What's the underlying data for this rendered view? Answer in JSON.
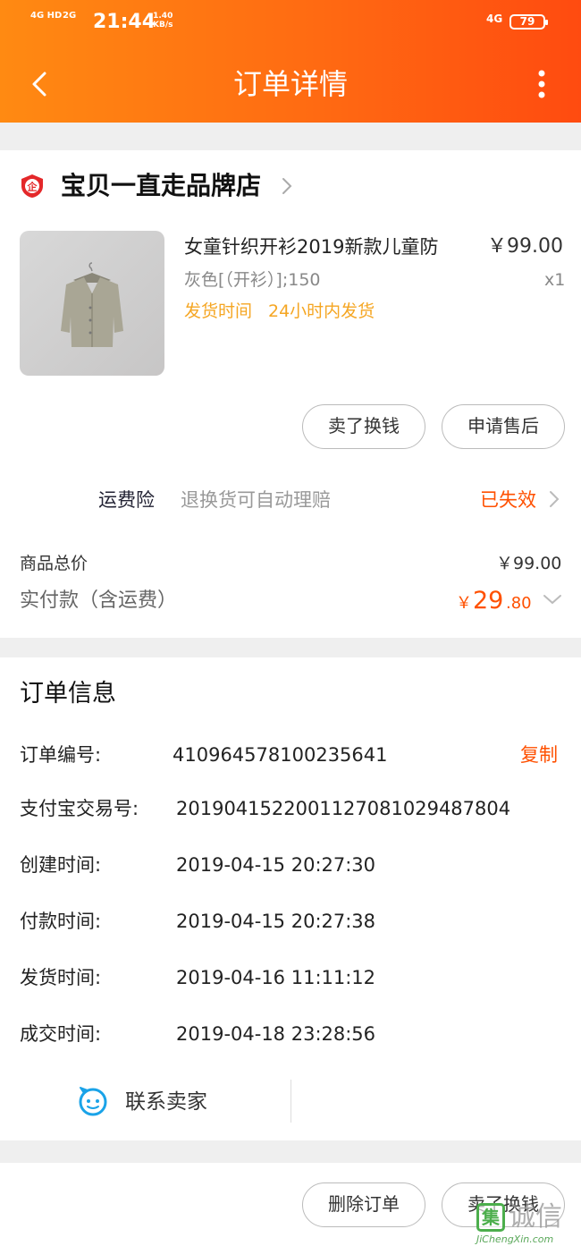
{
  "status_bar": {
    "net1": "4G HD",
    "net2": "2G",
    "time": "21:44",
    "speed_value": "1.40",
    "speed_unit": "KB/s",
    "net3": "4G",
    "battery": "79"
  },
  "nav": {
    "title": "订单详情"
  },
  "shop": {
    "name": "宝贝一直走品牌店",
    "badge": "企"
  },
  "product": {
    "title": "女童针织开衫2019新款儿童防",
    "price": "￥99.00",
    "spec": "灰色[（开衫）];150",
    "qty": "x1",
    "ship_label": "发货时间",
    "ship_value": "24小时内发货"
  },
  "actions": {
    "sell_label": "卖了换钱",
    "aftersale_label": "申请售后",
    "delete_label": "删除订单",
    "sell2_label": "卖了换钱"
  },
  "insurance": {
    "label": "运费险",
    "desc": "退换货可自动理赔",
    "status": "已失效"
  },
  "totals": {
    "goods_label": "商品总价",
    "goods_value": "￥99.00",
    "paid_label": "实付款（含运费）",
    "paid_currency": "￥",
    "paid_int": "29",
    "paid_dec": ".80"
  },
  "order_info": {
    "title": "订单信息",
    "copy_label": "复制",
    "rows": [
      {
        "label": "订单编号:",
        "value": "410964578100235641"
      },
      {
        "label": "支付宝交易号:",
        "value": "2019041522001127081029487804"
      },
      {
        "label": "创建时间:",
        "value": "2019-04-15 20:27:30"
      },
      {
        "label": "付款时间:",
        "value": "2019-04-15 20:27:38"
      },
      {
        "label": "发货时间:",
        "value": "2019-04-16 11:11:12"
      },
      {
        "label": "成交时间:",
        "value": "2019-04-18 23:28:56"
      }
    ]
  },
  "contact": {
    "label": "联系卖家"
  },
  "watermark": {
    "mark": "集",
    "text": "诚信",
    "url": "JiChengXin.com"
  },
  "colors": {
    "header_start": "#ff8a12",
    "header_end": "#ff4b10",
    "accent": "#ff5000",
    "ship_text": "#f5a623",
    "contact_icon": "#1aa3e8"
  }
}
